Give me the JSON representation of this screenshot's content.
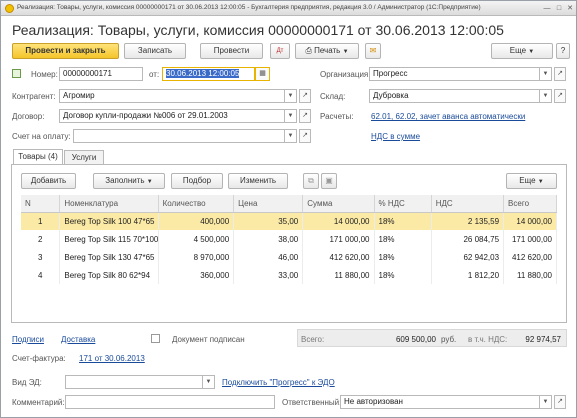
{
  "window": {
    "title": "Реализация: Товары, услуги, комиссия 00000000171 от 30.06.2013 12:00:05 - Бухгалтерия предприятия, редакция 3.0 / Администратор  (1С:Предприятие)"
  },
  "header": {
    "title": "Реализация: Товары, услуги, комиссия 00000000171 от 30.06.2013 12:00:05"
  },
  "toolbar": {
    "post_close": "Провести и закрыть",
    "save": "Записать",
    "post": "Провести",
    "print": "Печать",
    "more": "Еще",
    "help": "?"
  },
  "form": {
    "number_label": "Номер:",
    "number_value": "00000000171",
    "date_label": "от:",
    "date_value": "30.06.2013 12:00:05",
    "org_label": "Организация:",
    "org_value": "Прогресс",
    "counterparty_label": "Контрагент:",
    "counterparty_value": "Агромир",
    "warehouse_label": "Склад:",
    "warehouse_value": "Дубровка",
    "contract_label": "Договор:",
    "contract_value": "Договор купли-продажи №006 от 29.01.2003",
    "settlements_label": "Расчеты:",
    "settlements_link": "62.01, 62.02, зачет аванса автоматически",
    "invoice_label": "Счет на оплату:",
    "vat_link": "НДС в сумме"
  },
  "tabs": [
    {
      "label": "Товары (4)"
    },
    {
      "label": "Услуги"
    }
  ],
  "table_toolbar": {
    "add": "Добавить",
    "fill": "Заполнить",
    "select": "Подбор",
    "change": "Изменить",
    "more": "Еще"
  },
  "table": {
    "headers": [
      "N",
      "Номенклатура",
      "Количество",
      "Цена",
      "Сумма",
      "% НДС",
      "НДС",
      "Всего"
    ],
    "rows": [
      {
        "n": "1",
        "item": "Bereg Top Silk 100 47*65",
        "qty": "400,000",
        "price": "35,00",
        "sum": "14 000,00",
        "rate": "18%",
        "vat": "2 135,59",
        "total": "14 000,00"
      },
      {
        "n": "2",
        "item": "Bereg Top Silk 115 70*100",
        "qty": "4 500,000",
        "price": "38,00",
        "sum": "171 000,00",
        "rate": "18%",
        "vat": "26 084,75",
        "total": "171 000,00"
      },
      {
        "n": "3",
        "item": "Bereg Top Silk 130 47*65",
        "qty": "8 970,000",
        "price": "46,00",
        "sum": "412 620,00",
        "rate": "18%",
        "vat": "62 942,03",
        "total": "412 620,00"
      },
      {
        "n": "4",
        "item": "Bereg Top Silk 80 62*94",
        "qty": "360,000",
        "price": "33,00",
        "sum": "11 880,00",
        "rate": "18%",
        "vat": "1 812,20",
        "total": "11 880,00"
      }
    ]
  },
  "footer": {
    "signatures_link": "Подписи",
    "delivery_link": "Доставка",
    "doc_signed_label": "Документ подписан",
    "total_label": "Всего:",
    "total_value": "609 500,00",
    "currency": "руб.",
    "vat_incl_label": "в т.ч. НДС:",
    "vat_total_value": "92 974,57",
    "invoice_label": "Счет-фактура:",
    "invoice_link": "171 от 30.06.2013",
    "ed_type_label": "Вид ЭД:",
    "edo_link": "Подключить \"Прогресс\" к ЭДО",
    "comment_label": "Комментарий:",
    "responsible_label": "Ответственный:",
    "responsible_value": "Не авторизован"
  }
}
